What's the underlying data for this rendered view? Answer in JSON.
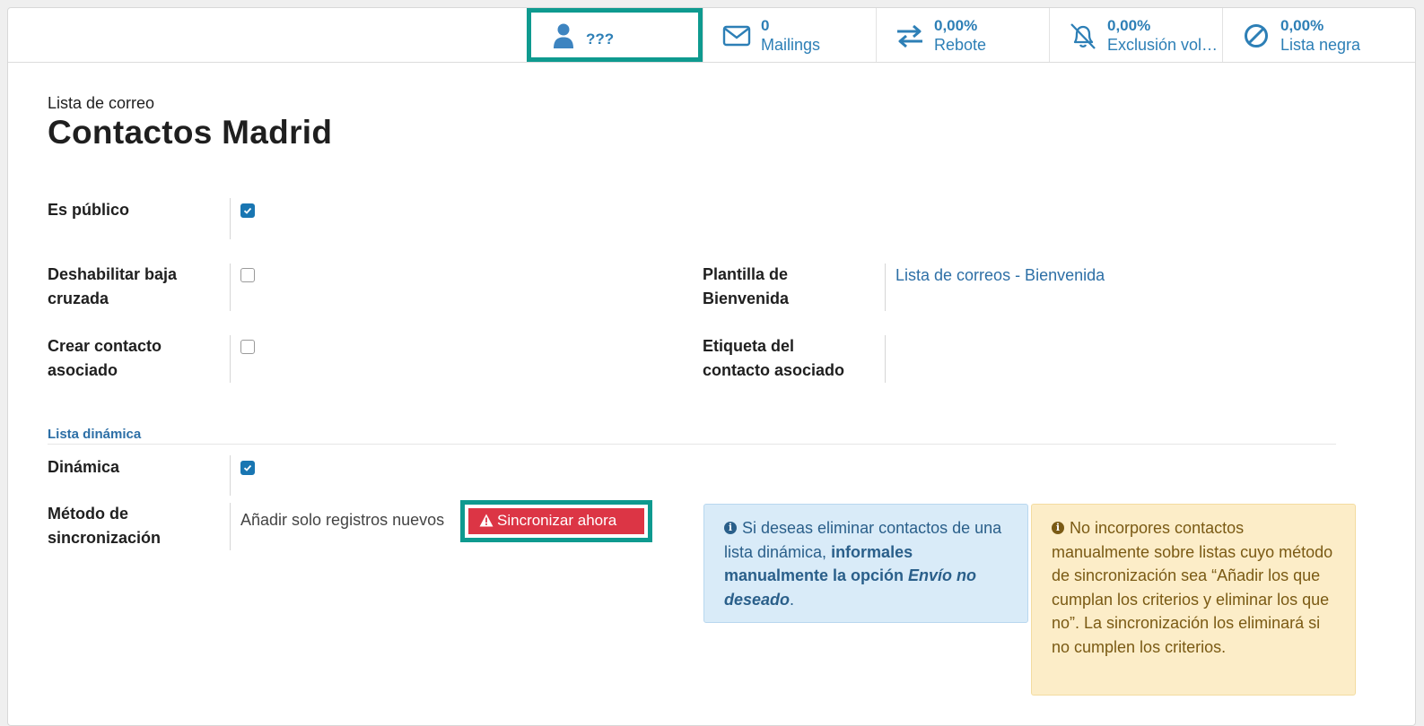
{
  "stats": [
    {
      "value": "???",
      "label": "",
      "icon": "user-icon"
    },
    {
      "value": "0",
      "label": "Mailings",
      "icon": "envelope-icon"
    },
    {
      "value": "0,00%",
      "label": "Rebote",
      "icon": "exchange-arrows-icon"
    },
    {
      "value": "0,00%",
      "label": "Exclusión voluntaria",
      "icon": "bell-slash-icon"
    },
    {
      "value": "0,00%",
      "label": "Lista negra",
      "icon": "ban-icon"
    }
  ],
  "record": {
    "subtitle": "Lista de correo",
    "title": "Contactos Madrid"
  },
  "fields": {
    "is_public": {
      "label": "Es público",
      "checked": true
    },
    "disable_cross_unsub": {
      "label_line1": "Deshabilitar baja",
      "label_line2": "cruzada",
      "checked": false
    },
    "create_partner": {
      "label_line1": "Crear contacto",
      "label_line2": "asociado",
      "checked": false
    },
    "welcome_template": {
      "label_line1": "Plantilla de",
      "label_line2": "Bienvenida",
      "value": "Lista de correos - Bienvenida"
    },
    "partner_tag": {
      "label_line1": "Etiqueta del",
      "label_line2": "contacto asociado",
      "value": ""
    },
    "dynamic": {
      "label": "Dinámica",
      "checked": true
    },
    "sync_method": {
      "label_line1": "Método de",
      "label_line2": "sincronización",
      "value": "Añadir solo registros nuevos"
    }
  },
  "section_dynamic": "Lista dinámica",
  "sync_button": "Sincronizar ahora",
  "info_alert": {
    "text1": "Si deseas eliminar contactos de una lista dinámica, ",
    "bold": "informales manualmente la opción ",
    "italic": "Envío no deseado",
    "end": "."
  },
  "warn_alert": "No incorpores contactos manualmente sobre listas cuyo método de sincronización sea “Añadir los que cumplan los criterios y eliminar los que no”. La sincronización los eliminará si no cumplen los criterios.",
  "colors": {
    "link": "#2d6fa6",
    "highlight": "#0e9a8f",
    "danger": "#dc3545",
    "checkbox": "#1976b2"
  }
}
